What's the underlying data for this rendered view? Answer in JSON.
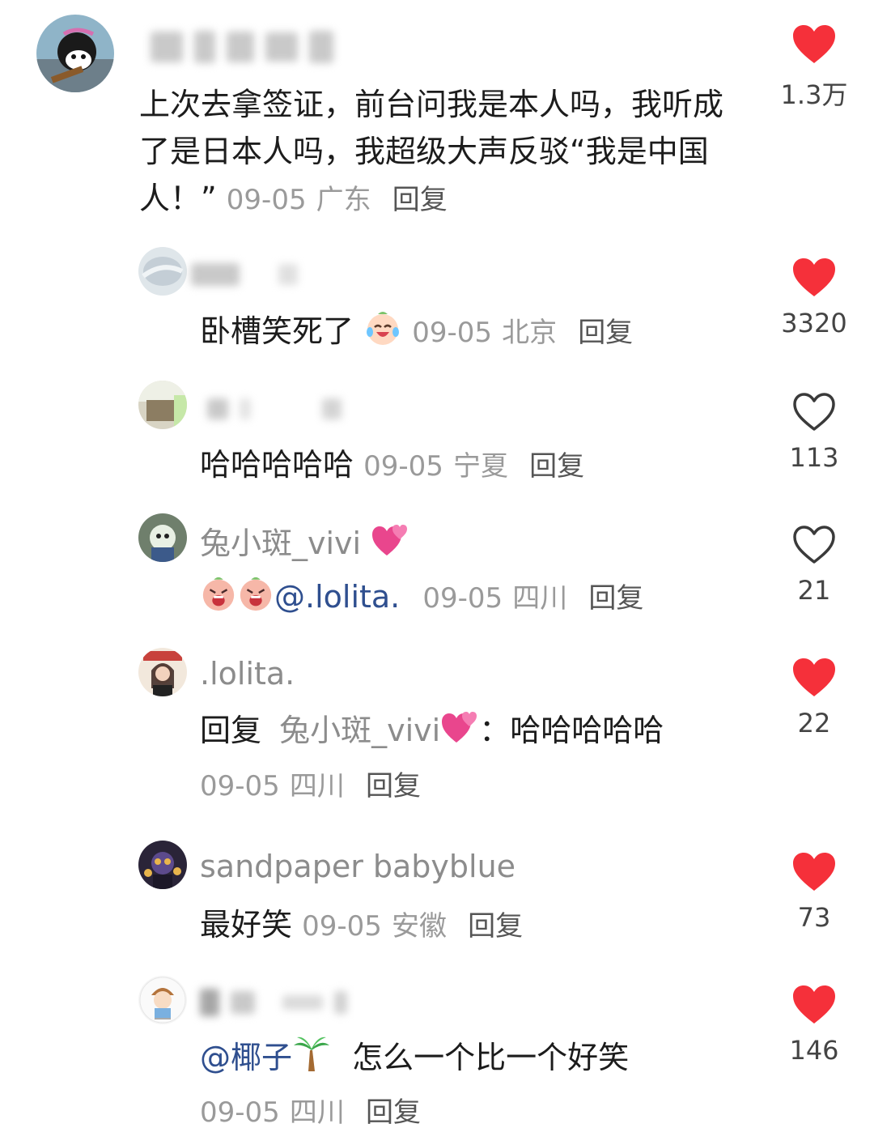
{
  "comments": [
    {
      "username": "",
      "text": "上次去拿签证，前台问我是本人吗，我听成了是日本人吗，我超级大声反驳“我是中国人！”",
      "date": "09-05",
      "location": "广东",
      "reply": "回复",
      "likes": "1.3万",
      "liked": true
    },
    {
      "username": "",
      "text": "卧槽笑死了",
      "emoji": "laughing-crying-face",
      "date": "09-05",
      "location": "北京",
      "reply": "回复",
      "likes": "3320",
      "liked": true
    },
    {
      "username": "",
      "text": "哈哈哈哈哈",
      "date": "09-05",
      "location": "宁夏",
      "reply": "回复",
      "likes": "113",
      "liked": false
    },
    {
      "username": "兔小斑_vivi",
      "username_emoji": "two-hearts",
      "mention": "@.lolita.",
      "emoji": "crying-face",
      "date": "09-05",
      "location": "四川",
      "reply": "回复",
      "likes": "21",
      "liked": false
    },
    {
      "username": ".lolita.",
      "reply_prefix": "回复",
      "reply_to": "兔小斑_vivi",
      "reply_to_emoji": "two-hearts",
      "colon": "：",
      "text": "哈哈哈哈哈",
      "date": "09-05",
      "location": "四川",
      "reply": "回复",
      "likes": "22",
      "liked": true
    },
    {
      "username": "sandpaper babyblue",
      "text": "最好笑",
      "date": "09-05",
      "location": "安徽",
      "reply": "回复",
      "likes": "73",
      "liked": true
    },
    {
      "username": "",
      "mention": "@椰子",
      "mention_emoji": "palm-tree",
      "text": "怎么一个比一个好笑",
      "date": "09-05",
      "location": "四川",
      "reply": "回复",
      "likes": "146",
      "liked": true
    }
  ],
  "colors": {
    "like_red": "#f5303a",
    "mention_blue": "#2f4f8f",
    "meta_gray": "#9a9a9a"
  }
}
